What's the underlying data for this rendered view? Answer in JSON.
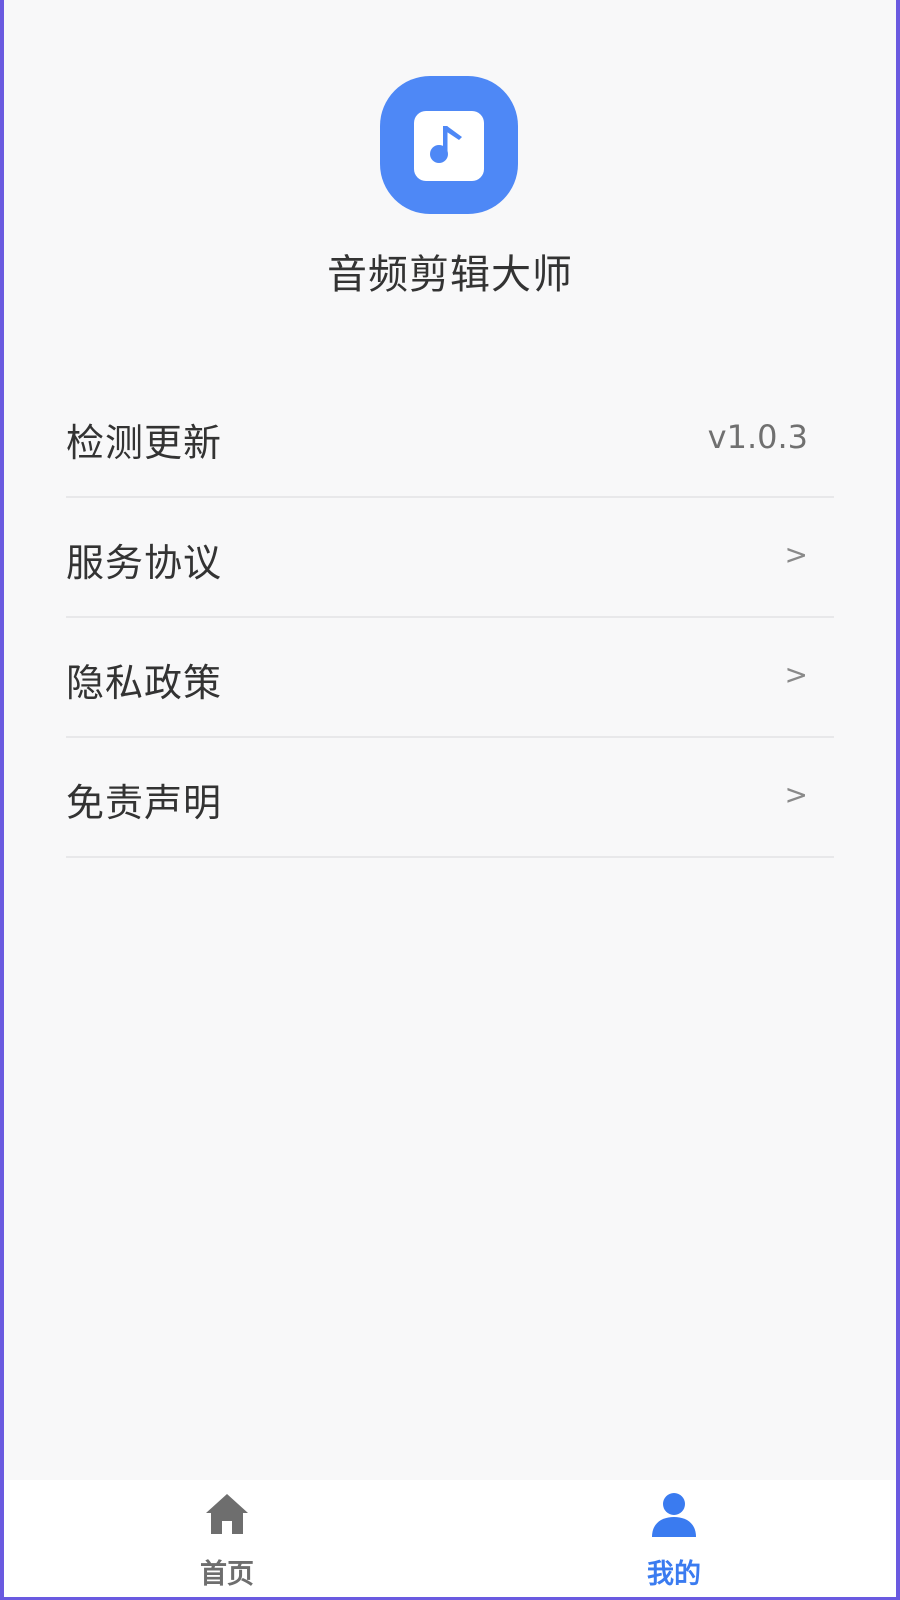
{
  "app": {
    "name": "音频剪辑大师",
    "logo_icon": "music-note-icon",
    "brand_color": "#4e88f6"
  },
  "menu": {
    "items": [
      {
        "label": "检测更新",
        "value": "v1.0.3"
      },
      {
        "label": "服务协议",
        "chevron": ">"
      },
      {
        "label": "隐私政策",
        "chevron": ">"
      },
      {
        "label": "免责声明",
        "chevron": ">"
      }
    ]
  },
  "tabbar": {
    "tabs": [
      {
        "label": "首页",
        "icon": "home-icon",
        "active": false
      },
      {
        "label": "我的",
        "icon": "user-icon",
        "active": true
      }
    ],
    "active_color": "#3a7bf0",
    "inactive_color": "#6e6e6e"
  }
}
